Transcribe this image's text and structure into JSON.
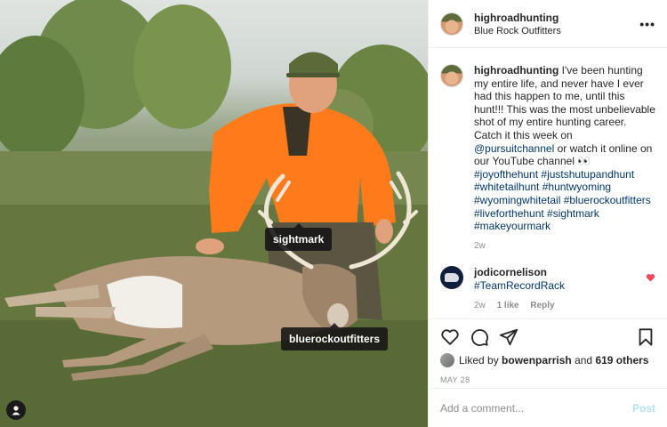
{
  "post": {
    "username": "highroadhunting",
    "location": "Blue Rock Outfitters",
    "more_icon": "more-dots-icon",
    "photo_tags": [
      "sightmark",
      "bluerockoutfitters"
    ],
    "user_tag_icon": "person-icon"
  },
  "caption": {
    "username": "highroadhunting",
    "text_before": " I've been hunting my entire life, and never have I ever had this happen to me, until this hunt!!! This was the most unbelievable shot of my entire hunting career. Catch it this week on ",
    "mention": "@pursuitchannel",
    "text_after": " or watch it online on our YouTube channel 👀",
    "hashtags": "#joyofthehunt #justshutupandhunt #whitetailhunt #huntwyoming #wyomingwhitetail #bluerockoutfitters #liveforthehunt #sightmark #makeyourmark",
    "time": "2w"
  },
  "comment": {
    "username": "jodicornelison",
    "text": "#TeamRecordRack",
    "time": "2w",
    "likes": "1 like",
    "reply_label": "Reply",
    "heart_icon": "heart-icon"
  },
  "actions": {
    "icons": [
      "heart-icon",
      "comment-icon",
      "share-icon",
      "bookmark-icon"
    ]
  },
  "likes": {
    "prefix": "Liked by",
    "liker": "bowenparrish",
    "and": "and",
    "others": "619 others"
  },
  "date": "MAY 28",
  "add_comment": {
    "placeholder": "Add a comment...",
    "post_label": "Post"
  },
  "colors": {
    "link": "#00376b",
    "post_button": "#b2dffc",
    "heart": "#ed4956",
    "secondary_text": "#8e8e8e",
    "hunter_orange": "#ff7a1a"
  }
}
